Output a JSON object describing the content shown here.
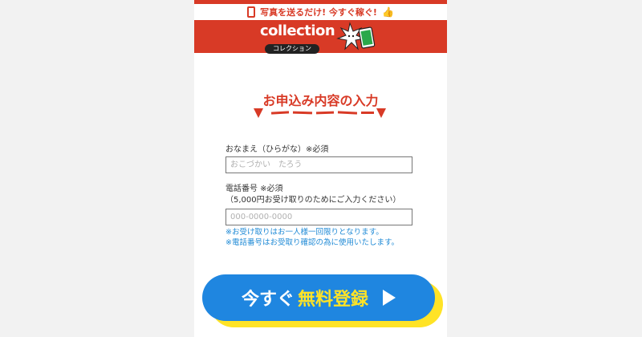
{
  "header": {
    "tagline": "写真を送るだけ! 今すぐ稼ぐ!",
    "logo_text": "collection",
    "logo_subtext": "コレクション"
  },
  "form": {
    "heading": "お申込み内容の入力",
    "name_label": "おなまえ（ひらがな）※必須",
    "name_placeholder": "おこづかい　たろう",
    "phone_label": "電話番号 ※必須",
    "phone_sublabel": "（5,000円お受け取りのためにご入力ください）",
    "phone_placeholder": "000-0000-0000",
    "notes": [
      "※お受け取りはお一人様一回限りとなります。",
      "※電話番号はお受取り確認の為に使用いたします。"
    ]
  },
  "cta": {
    "prefix": "今すぐ",
    "highlight": "無料登録"
  },
  "colors": {
    "brand_red": "#d83a26",
    "cta_blue": "#1f86e0",
    "cta_yellow": "#ffe326",
    "note_blue": "#1f8ad6"
  }
}
